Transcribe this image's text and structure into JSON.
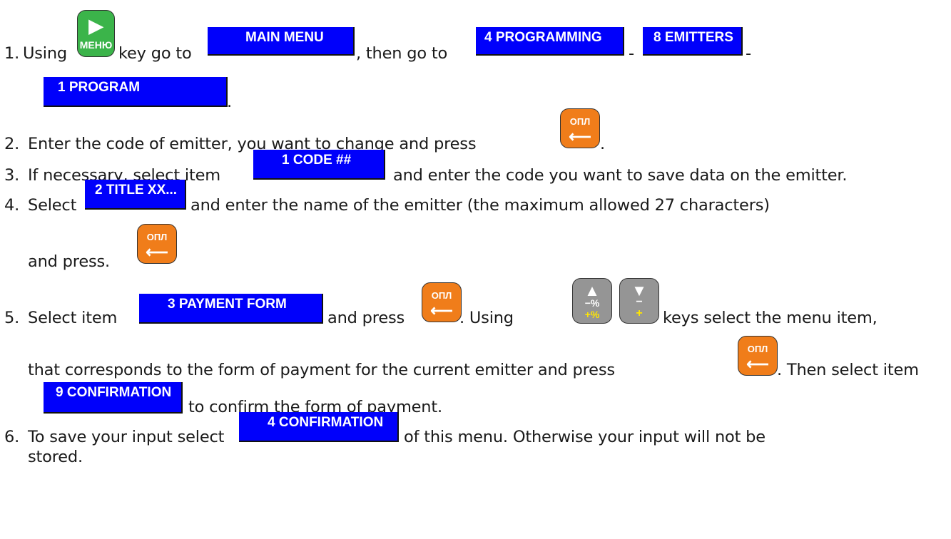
{
  "steps": [
    {
      "num": "1.",
      "parts": [
        "Using",
        "key go to",
        ", then go to",
        "-",
        "-",
        "."
      ]
    },
    {
      "num": "2.",
      "parts": [
        "Enter the code of emitter, you want to change and press",
        "."
      ]
    },
    {
      "num": "3.",
      "parts": [
        "If necessary, select item",
        "and enter the code you want to save data on the emitter."
      ]
    },
    {
      "num": "4.",
      "parts": [
        "Select",
        "and enter the name of the emitter (the maximum allowed 27 characters)",
        "and press."
      ]
    },
    {
      "num": "5.",
      "parts": [
        "Select item",
        "and press",
        ".  Using",
        "keys select the menu item,",
        "that corresponds to the form of payment for the current emitter and press",
        ". Then select item",
        "to confirm the form of payment."
      ]
    },
    {
      "num": "6.",
      "parts": [
        "To save your input select",
        "of this menu. Otherwise your input will not be",
        "stored."
      ]
    }
  ],
  "menus": {
    "main_menu": "MAIN MENU",
    "programming": "4 PROGRAMMING",
    "emitters": "8 EMITTERS",
    "program": "1 PROGRAM",
    "code": "1 CODE ##",
    "title": "2 TITLE XX...",
    "payment_form": "3 PAYMENT FORM",
    "confirmation_9": "9 CONFIRMATION",
    "confirmation_4": "4 CONFIRMATION"
  },
  "keys": {
    "menu_key": {
      "label": "МЕНЮ",
      "glyph": "▶",
      "icon": "play-icon"
    },
    "pay_key": {
      "label": "ОПЛ",
      "glyph": "⟵",
      "icon": "enter-icon"
    },
    "up_key": {
      "glyph": "▲",
      "sub1": "−%",
      "sub2": "+%",
      "icon": "arrow-up-icon"
    },
    "down_key": {
      "glyph": "▼",
      "sub1": "−",
      "sub2": "+",
      "icon": "arrow-down-icon"
    }
  },
  "colors": {
    "menu_blue": "#0000fb",
    "key_orange": "#f07d1a",
    "key_green": "#3bb44a",
    "key_gray": "#959595",
    "key_yellow": "#ffe600"
  }
}
